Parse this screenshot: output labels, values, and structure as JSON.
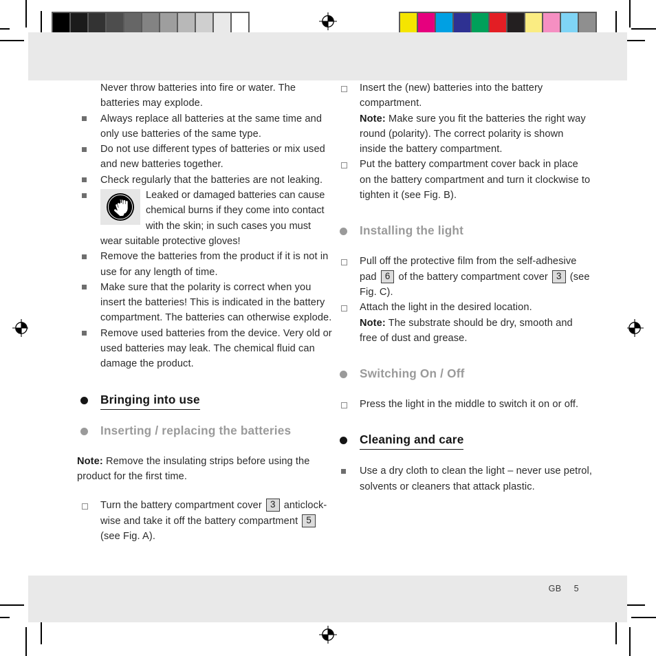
{
  "document": {
    "footer": {
      "locale": "GB",
      "page_number": "5"
    }
  },
  "calibration": {
    "gray_strip": {
      "name": "grayscale-calibration-strip",
      "swatches": [
        "#000000",
        "#1b1b1b",
        "#333333",
        "#4d4d4d",
        "#666666",
        "#838383",
        "#9e9e9e",
        "#b8b8b8",
        "#cfcfcf",
        "#e9e9e9",
        "#ffffff"
      ]
    },
    "color_strip": {
      "name": "color-calibration-strip",
      "swatches": [
        "#f5e500",
        "#e6007e",
        "#00a0e3",
        "#2e3192",
        "#00a05a",
        "#e31e24",
        "#231f20",
        "#faec82",
        "#f58fc2",
        "#7fd4f5",
        "#8f8f8f"
      ]
    }
  },
  "left_column": {
    "warnings": [
      {
        "bullet": "none",
        "text": "Never throw batteries into fire or water. The batteries may explode."
      },
      {
        "bullet": "square",
        "text": "Always replace all batteries at the same time and only use batteries of the same type."
      },
      {
        "bullet": "square",
        "text": "Do not use different types of batteries or mix used and new batteries together."
      },
      {
        "bullet": "square",
        "text": "Check regularly that the batteries are not leaking."
      }
    ],
    "glove_warning": {
      "icon": "protective-gloves-icon",
      "text": "Leaked or damaged batteries can cause chemical burns if they come into contact with the skin; in such cases you must wear suitable protective gloves!"
    },
    "warnings_after": [
      {
        "bullet": "square",
        "text": "Remove the batteries from the product if it is not in use for any length of time."
      },
      {
        "bullet": "square",
        "text": "Make sure that the polarity is correct when you insert the batteries! This is indicated in the battery compartment. The batteries can otherwise explode."
      },
      {
        "bullet": "square",
        "text": "Remove used batteries from the device. Very old or used batteries may leak. The chemical fluid can damage the product."
      }
    ],
    "heading_bringing_into_use": "Bringing into use",
    "heading_inserting_batteries": "Inserting / replacing the batteries",
    "note_label": "Note:",
    "note_text": " Remove the insulating strips before using the product for the first time.",
    "step_turn_cover": {
      "part1": "Turn the battery compartment cover ",
      "ref1": "3",
      "part2": " anticlock-wise and take it off the battery compartment ",
      "ref2": "5",
      "part3": " (see Fig. A)."
    }
  },
  "right_column": {
    "step_insert_batteries": {
      "text": "Insert the (new) batteries into the battery compartment.",
      "note_label": "Note:",
      "note_text": " Make sure you fit the batteries the right way round (polarity). The correct polarity is shown inside the battery compartment."
    },
    "step_put_cover_back": {
      "text": "Put the battery compartment cover back in place on the battery compartment and turn it clockwise to tighten it (see Fig. B)."
    },
    "heading_installing_the_light": "Installing the light",
    "step_pull_film": {
      "part1": "Pull off the protective film from the self-adhesive pad ",
      "ref1": "6",
      "part2": " of the battery compartment cover ",
      "ref2": "3",
      "part3": " (see Fig. C)."
    },
    "step_attach_light": {
      "text": "Attach the light in the desired location.",
      "note_label": "Note:",
      "note_text": " The substrate should be dry, smooth and free of dust and grease."
    },
    "heading_switching_on_off": "Switching On / Off",
    "step_press_light": {
      "text": "Press the light in the middle to switch it on or off."
    },
    "heading_cleaning_and_care": "Cleaning and care",
    "step_dry_cloth": {
      "text": "Use a dry cloth to clean the light – never use petrol, solvents or cleaners that attack plastic."
    }
  }
}
